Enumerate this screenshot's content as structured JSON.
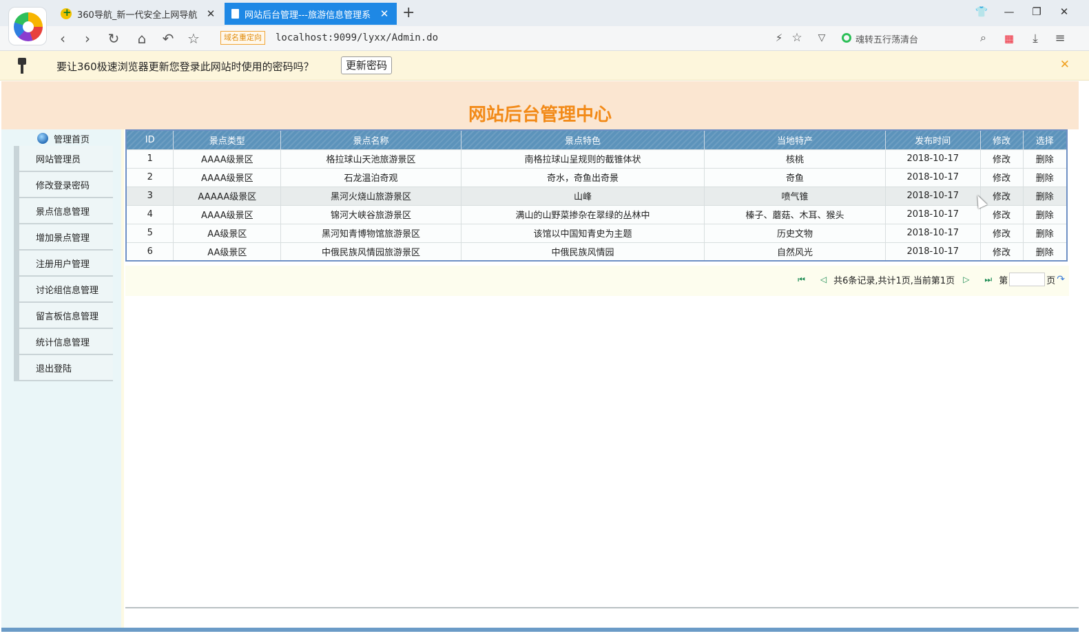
{
  "browser": {
    "tabs": [
      {
        "title": "360导航_新一代安全上网导航",
        "active": false
      },
      {
        "title": "网站后台管理---旅游信息管理系",
        "active": true
      }
    ],
    "redirect_badge": "域名重定向",
    "url": "localhost:9099/lyxx/Admin.do",
    "search_text": "魂转五行荡清台"
  },
  "password_bar": {
    "message": "要让360极速浏览器更新您登录此网站时使用的密码吗？",
    "button": "更新密码"
  },
  "page": {
    "title": "网站后台管理中心",
    "sidebar": {
      "home": "管理首页",
      "items": [
        "网站管理员",
        "修改登录密码",
        "景点信息管理",
        "增加景点管理",
        "注册用户管理",
        "讨论组信息管理",
        "留言板信息管理",
        "统计信息管理",
        "退出登陆"
      ]
    },
    "table": {
      "headers": [
        "ID",
        "景点类型",
        "景点名称",
        "景点特色",
        "当地特产",
        "发布时间",
        "修改",
        "选择"
      ],
      "rows": [
        [
          "1",
          "AAAA级景区",
          "格拉球山天池旅游景区",
          "南格拉球山呈规则的截锥体状",
          "核桃",
          "2018-10-17",
          "修改",
          "删除"
        ],
        [
          "2",
          "AAAA级景区",
          "石龙温泊奇观",
          "奇水，奇鱼出奇景",
          "奇鱼",
          "2018-10-17",
          "修改",
          "删除"
        ],
        [
          "3",
          "AAAAA级景区",
          "黑河火烧山旅游景区",
          "山峰",
          "喷气锥",
          "2018-10-17",
          "修改",
          "删除"
        ],
        [
          "4",
          "AAAA级景区",
          "锦河大峡谷旅游景区",
          "满山的山野菜掺杂在翠绿的丛林中",
          "榛子、蘑菇、木耳、猴头",
          "2018-10-17",
          "修改",
          "删除"
        ],
        [
          "5",
          "AA级景区",
          "黑河知青博物馆旅游景区",
          "该馆以中国知青史为主题",
          "历史文物",
          "2018-10-17",
          "修改",
          "删除"
        ],
        [
          "6",
          "AA级景区",
          "中俄民族风情园旅游景区",
          "中俄民族风情园",
          "自然风光",
          "2018-10-17",
          "修改",
          "删除"
        ]
      ],
      "highlight_row": 3
    },
    "pager": {
      "first": "⏮",
      "prev": "◁",
      "summary": "共6条记录,共计1页,当前第1页",
      "next": "▷",
      "last": "⏭",
      "page_label_pre": "第",
      "page_label_post": "页"
    }
  },
  "colors": {
    "banner_bg": "#fbe6d1",
    "title": "#f28a18",
    "table_header": "#5c93bb",
    "tab_active": "#1e88e5"
  }
}
